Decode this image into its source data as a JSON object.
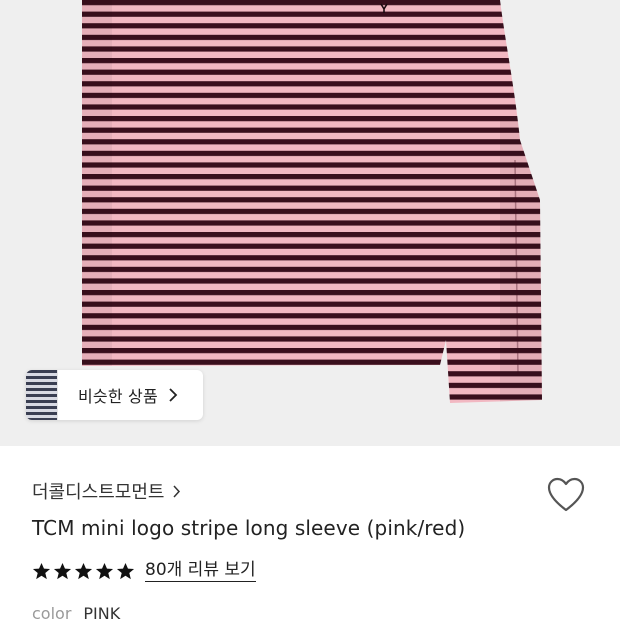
{
  "product": {
    "image_icon": "striped-long-sleeve-shirt",
    "stripe_colors": {
      "light": "#f2b8c2",
      "dark": "#3a0f1d"
    },
    "similar_button": {
      "label": "비슷한 상품",
      "icon": "chevron-right-icon"
    },
    "brand": "더콜디스트모먼트",
    "brand_icon": "chevron-right-icon",
    "wishlist_icon": "heart-outline-icon",
    "title": "TCM mini logo stripe long sleeve (pink/red)",
    "rating": {
      "stars": 5,
      "max": 5,
      "review_link": "80개 리뷰 보기"
    },
    "options": {
      "color_label": "color",
      "color_value": "PINK"
    }
  }
}
